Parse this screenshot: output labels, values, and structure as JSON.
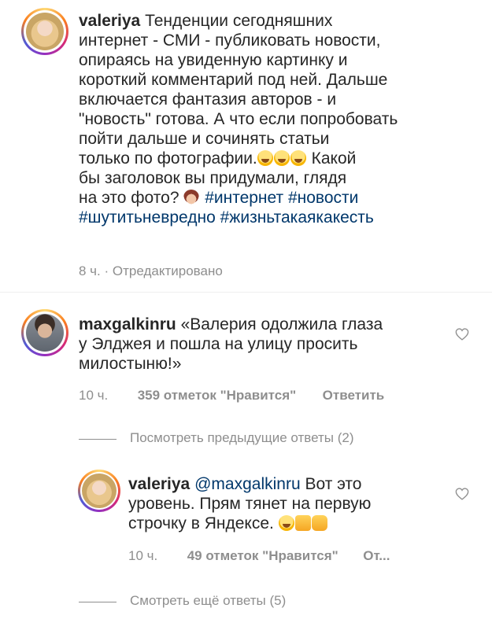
{
  "caption": {
    "username": "valeriya",
    "text_lines": [
      "Тенденции сегодняшних",
      "интернет - СМИ - публиковать новости,",
      "опираясь на увиденную картинку и",
      "короткий комментарий под ней. Дальше",
      "включается фантазия авторов - и",
      "\"новость\" готова. А что если попробовать",
      "пойти дальше и сочинять статьи",
      "только по фотографии.",
      "Какой",
      "бы заголовок вы придумали, глядя",
      "на это фото?"
    ],
    "hashtags_line1": "#интернет #новости",
    "hashtags_line2": "#шутитьневредно #жизньтакаякакесть",
    "time": "8 ч.",
    "edited": "Отредактировано",
    "separator": "·"
  },
  "comment1": {
    "username": "maxgalkinru",
    "text_lines": [
      "«Валерия одолжила глаза",
      "у Элджея и пошла на улицу просить",
      "милостыню!»"
    ],
    "time": "10 ч.",
    "likes": "359 отметок \"Нравится\"",
    "reply": "Ответить",
    "view_previous": "Посмотреть предыдущие ответы (2)"
  },
  "reply1": {
    "username": "valeriya",
    "mention": "@maxgalkinru",
    "text_line1_rest": "Вот это",
    "text_lines": [
      "уровень. Прям тянет на первую",
      "строчку в Яндексе."
    ],
    "time": "10 ч.",
    "likes": "49 отметок \"Нравится\"",
    "reply": "От...",
    "view_more": "Смотреть ещё ответы (5)"
  },
  "colors": {
    "text": "#262626",
    "secondary": "#8e8e8e",
    "link": "#00376b",
    "divider": "#dbdbdb"
  },
  "icons": {
    "heart": "heart-outline-icon"
  }
}
